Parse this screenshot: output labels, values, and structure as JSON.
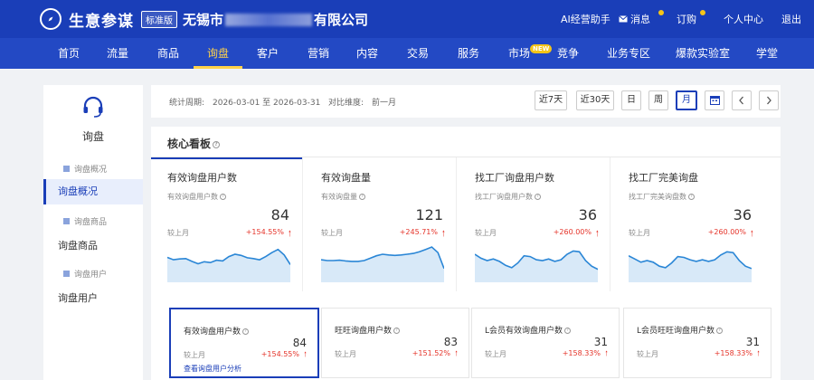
{
  "header": {
    "brand": "生意参谋",
    "edition": "标准版",
    "shop_prefix": "无锡市",
    "shop_suffix": "有限公司",
    "ai_assistant": "AI经营助手",
    "messages": "消息",
    "orders": "订购",
    "user_center": "个人中心",
    "logout": "退出"
  },
  "nav": {
    "items": [
      "首页",
      "流量",
      "商品",
      "询盘",
      "客户",
      "营销",
      "内容",
      "交易",
      "服务",
      "市场",
      "竞争",
      "业务专区",
      "爆款实验室",
      "学堂"
    ],
    "active": "询盘",
    "new_badge": "NEW"
  },
  "sidebar": {
    "title": "询盘",
    "items": [
      {
        "label": "询盘概况",
        "type": "sub"
      },
      {
        "label": "询盘概况",
        "type": "main",
        "active": true
      },
      {
        "label": "询盘商品",
        "type": "sub"
      },
      {
        "label": "询盘商品",
        "type": "main"
      },
      {
        "label": "询盘用户",
        "type": "sub"
      },
      {
        "label": "询盘用户",
        "type": "main"
      }
    ]
  },
  "filter": {
    "period_label": "统计周期:",
    "period_value": "2026-03-01 至 2026-03-31",
    "compare_label": "对比维度:",
    "compare_value": "前一月",
    "btn_7d": "近7天",
    "btn_30d": "近30天",
    "btn_day": "日",
    "btn_week": "周",
    "btn_month": "月"
  },
  "panel": {
    "title": "核心看板",
    "cards": [
      {
        "title": "有效询盘用户数",
        "sub": "有效询盘用户数",
        "value": "84",
        "compare": "较上月",
        "pct": "+154.55%",
        "active": true,
        "trend": [
          0.58,
          0.52,
          0.54,
          0.55,
          0.48,
          0.42,
          0.47,
          0.45,
          0.51,
          0.49,
          0.6,
          0.66,
          0.63,
          0.57,
          0.55,
          0.52,
          0.6,
          0.7,
          0.78,
          0.64,
          0.4
        ]
      },
      {
        "title": "有效询盘量",
        "sub": "有效询盘量",
        "value": "121",
        "compare": "较上月",
        "pct": "+245.71%",
        "trend": [
          0.52,
          0.5,
          0.5,
          0.51,
          0.49,
          0.48,
          0.48,
          0.5,
          0.56,
          0.62,
          0.66,
          0.64,
          0.63,
          0.64,
          0.66,
          0.68,
          0.72,
          0.78,
          0.84,
          0.7,
          0.3
        ]
      },
      {
        "title": "找工厂询盘用户数",
        "sub": "找工厂询盘用户数",
        "value": "36",
        "compare": "较上月",
        "pct": "+260.00%",
        "trend": [
          0.66,
          0.56,
          0.5,
          0.54,
          0.48,
          0.38,
          0.32,
          0.44,
          0.62,
          0.6,
          0.52,
          0.5,
          0.54,
          0.48,
          0.52,
          0.66,
          0.74,
          0.72,
          0.5,
          0.36,
          0.28
        ]
      },
      {
        "title": "找工厂完美询盘",
        "sub": "找工厂完美询盘数",
        "value": "36",
        "compare": "较上月",
        "pct": "+260.00%",
        "trend": [
          0.62,
          0.54,
          0.46,
          0.5,
          0.46,
          0.36,
          0.32,
          0.44,
          0.6,
          0.58,
          0.52,
          0.48,
          0.52,
          0.48,
          0.52,
          0.64,
          0.72,
          0.7,
          0.5,
          0.36,
          0.3
        ]
      }
    ],
    "mini_cards": [
      {
        "title": "有效询盘用户数",
        "value": "84",
        "compare": "较上月",
        "pct": "+154.55%",
        "link": "查看询盘用户分析",
        "active": true
      },
      {
        "title": "旺旺询盘用户数",
        "value": "83",
        "compare": "较上月",
        "pct": "+151.52%"
      },
      {
        "title": "L会员有效询盘用户数",
        "value": "31",
        "compare": "较上月",
        "pct": "+158.33%"
      },
      {
        "title": "L会员旺旺询盘用户数",
        "value": "31",
        "compare": "较上月",
        "pct": "+158.33%"
      }
    ]
  },
  "colors": {
    "header_bg": "#1a3eb8",
    "nav_bg": "#2349c4",
    "active_nav": "#ffd24a",
    "accent": "#1a3eb8",
    "positive": "#e5342a",
    "spark_line": "#2a86d6",
    "spark_fill": "#d8e9f8"
  }
}
